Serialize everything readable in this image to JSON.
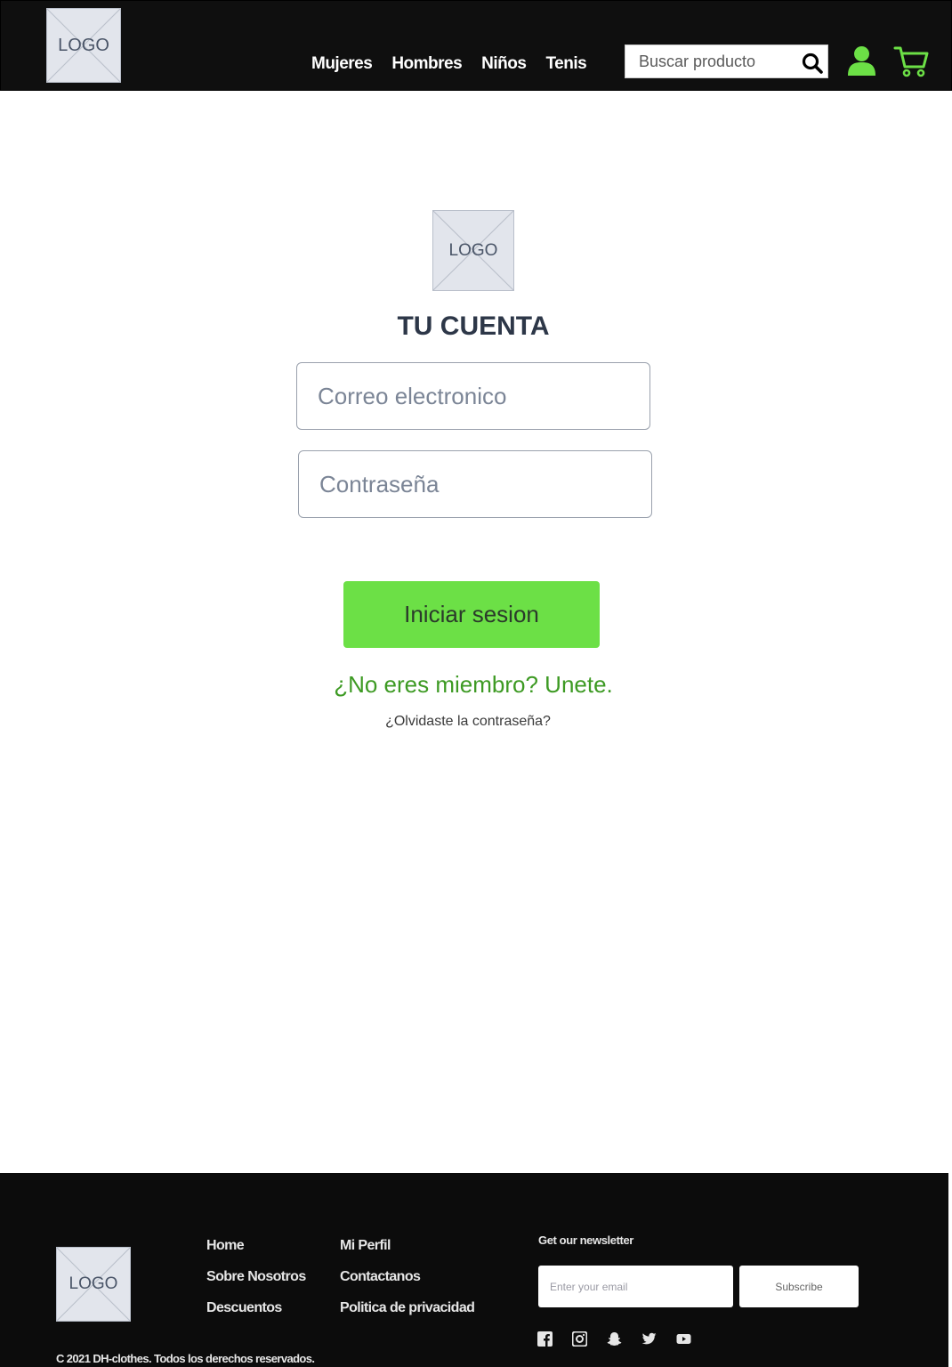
{
  "header": {
    "logo_text": "LOGO",
    "nav": [
      "Mujeres",
      "Hombres",
      "Niños",
      "Tenis"
    ],
    "search_placeholder": "Buscar producto"
  },
  "login": {
    "logo_text": "LOGO",
    "title": "TU CUENTA",
    "email_placeholder": "Correo electronico",
    "password_placeholder": "Contraseña",
    "submit_label": "Iniciar sesion",
    "join_text": "¿No eres miembro? Unete.",
    "forgot_text": "¿Olvidaste la contraseña?"
  },
  "footer": {
    "logo_text": "LOGO",
    "col1": [
      "Home",
      "Sobre Nosotros",
      "Descuentos"
    ],
    "col2": [
      "Mi Perfil",
      "Contactanos",
      "Politica de privacidad"
    ],
    "newsletter_title": "Get our newsletter",
    "newsletter_placeholder": "Enter your email",
    "subscribe_label": "Subscribe",
    "socials": [
      "facebook-icon",
      "instagram-icon",
      "snapchat-icon",
      "twitter-icon",
      "youtube-icon"
    ],
    "copyright": "C 2021 DH-clothes. Todos los derechos reservados."
  },
  "colors": {
    "accent_green": "#6ce046",
    "link_green": "#3d9a23",
    "header_bg": "#0f0f0f"
  }
}
